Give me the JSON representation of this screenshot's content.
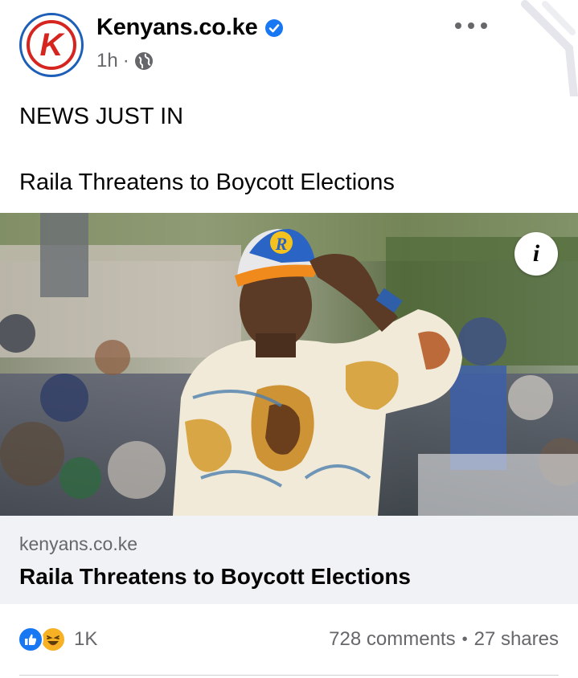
{
  "post": {
    "page_name": "Kenyans.co.ke",
    "avatar_letter": "K",
    "time": "1h",
    "time_separator": "·",
    "text_line1": "NEWS JUST IN",
    "text_line2": "Raila Threatens to Boycott Elections"
  },
  "link_preview": {
    "domain": "kenyans.co.ke",
    "title": "Raila Threatens to Boycott Elections",
    "info_glyph": "i",
    "cap_letter": "R"
  },
  "engagement": {
    "reaction_count": "1K",
    "comments": "728 comments",
    "separator": "•",
    "shares": "27 shares"
  },
  "icons": {
    "verified": "verified-badge-icon",
    "privacy": "globe-icon",
    "more": "more-options-icon",
    "info": "info-icon",
    "like": "like-reaction-icon",
    "haha": "haha-reaction-icon"
  },
  "colors": {
    "brand_blue": "#1877f2",
    "text_primary": "#050505",
    "text_secondary": "#65676b",
    "link_box_bg": "#f0f2f5",
    "kenyans_red": "#d6241f"
  }
}
